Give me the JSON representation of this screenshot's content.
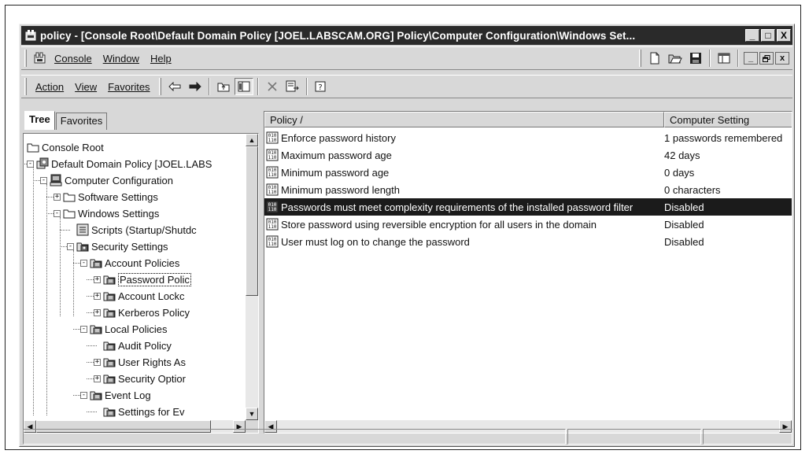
{
  "window": {
    "title": "policy - [Console Root\\Default Domain Policy [JOEL.LABSCAM.ORG] Policy\\Computer Configuration\\Windows Set...",
    "controls": [
      "_",
      "□",
      "X"
    ]
  },
  "menubar": {
    "items": [
      "Console",
      "Window",
      "Help"
    ],
    "mdi_controls": [
      "_",
      "ₗ",
      "x"
    ]
  },
  "toolbar": {
    "items": [
      "Action",
      "View",
      "Favorites"
    ]
  },
  "tabs": [
    "Tree",
    "Favorites"
  ],
  "tree": [
    {
      "label": "Console Root",
      "icon": "folder-icon"
    },
    {
      "label": "Default Domain Policy [JOEL.LABS",
      "icon": "policy-icon",
      "expander": "-"
    },
    {
      "label": "Computer Configuration",
      "icon": "computer-icon",
      "expander": "-"
    },
    {
      "label": "Software Settings",
      "icon": "folder-icon",
      "expander": "+"
    },
    {
      "label": "Windows Settings",
      "icon": "folder-icon",
      "expander": "-"
    },
    {
      "label": "Scripts (Startup/Shutdc",
      "icon": "script-icon"
    },
    {
      "label": "Security Settings",
      "icon": "security-icon",
      "expander": "-"
    },
    {
      "label": "Account Policies",
      "icon": "policy-folder-icon",
      "expander": "-"
    },
    {
      "label": "Password Polic",
      "icon": "policy-folder-icon",
      "expander": "+",
      "selected": true
    },
    {
      "label": "Account Lockc",
      "icon": "policy-folder-icon",
      "expander": "+"
    },
    {
      "label": "Kerberos Policy",
      "icon": "policy-folder-icon",
      "expander": "+"
    },
    {
      "label": "Local Policies",
      "icon": "policy-folder-icon",
      "expander": "-"
    },
    {
      "label": "Audit Policy",
      "icon": "policy-folder-icon"
    },
    {
      "label": "User Rights As",
      "icon": "policy-folder-icon",
      "expander": "+"
    },
    {
      "label": "Security Optior",
      "icon": "policy-folder-icon",
      "expander": "+"
    },
    {
      "label": "Event Log",
      "icon": "policy-folder-icon",
      "expander": "-"
    },
    {
      "label": "Settings for Ev",
      "icon": "policy-folder-icon"
    }
  ],
  "list": {
    "columns": [
      "Policy  /",
      "Computer Setting"
    ],
    "rows": [
      {
        "policy": "Enforce password history",
        "setting": "1 passwords remembered"
      },
      {
        "policy": "Maximum password age",
        "setting": "42 days"
      },
      {
        "policy": "Minimum password age",
        "setting": "0 days"
      },
      {
        "policy": "Minimum password length",
        "setting": "0 characters"
      },
      {
        "policy": "Passwords must meet complexity requirements of the installed password filter",
        "setting": "Disabled",
        "selected": true
      },
      {
        "policy": "Store password using reversible encryption for all users in the domain",
        "setting": "Disabled"
      },
      {
        "policy": "User must log on to change the password",
        "setting": "Disabled"
      }
    ]
  }
}
